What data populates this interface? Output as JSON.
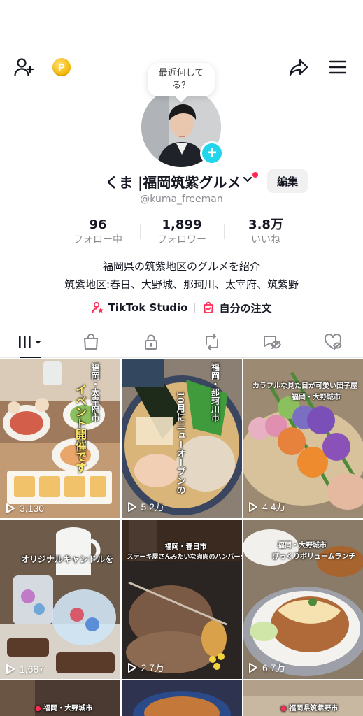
{
  "bubble": {
    "text": "最近何してる？"
  },
  "profile": {
    "display_name": "くま |福岡筑紫グルメ",
    "edit_label": "編集",
    "username": "@kuma_freeman"
  },
  "stats": [
    {
      "value": "96",
      "label": "フォロー中"
    },
    {
      "value": "1,899",
      "label": "フォロワー"
    },
    {
      "value": "3.8万",
      "label": "いいね"
    }
  ],
  "bio": {
    "line1": "福岡県の筑紫地区のグルメを紹介",
    "line2": "筑紫地区:春日、大野城、那珂川、太宰府、筑紫野"
  },
  "links": {
    "studio": "TikTok Studio",
    "orders": "自分の注文"
  },
  "videos": [
    {
      "views": "3,130",
      "overlay_vertical": "福岡・太宰府市",
      "overlay_caption": "イベント開催です"
    },
    {
      "views": "5.2万",
      "overlay_vertical": "福岡・那珂川市",
      "overlay_caption": "10月にニューオープンの"
    },
    {
      "views": "4.4万",
      "overlay_tag": "カラフルな見た目が可愛い団子屋",
      "overlay_location": "福岡・大野城市"
    },
    {
      "views": "1,687",
      "overlay_caption": "オリジナルキャンドルを"
    },
    {
      "views": "2.7万",
      "overlay_location": "福岡・春日市",
      "overlay_tag": "ステーキ屋さんみたいな肉肉のハンバーグ"
    },
    {
      "views": "6.7万",
      "overlay_location": "福岡・大野城市",
      "overlay_tag": "びっくりボリュームランチ"
    },
    {
      "overlay_location": "福岡・大野城市"
    },
    {},
    {
      "overlay_location": "福岡県筑紫野市"
    }
  ],
  "colors": {
    "accent_red": "#fe2c55",
    "accent_cyan": "#20d5ec",
    "coin_gold": "#f4b400",
    "text_primary": "#161823",
    "text_secondary": "#8a8b91"
  },
  "icons": {
    "top_left": [
      "add-friend-icon",
      "coin-icon"
    ],
    "top_right": [
      "share-icon",
      "menu-icon"
    ],
    "tabs": [
      "videos-grid-icon",
      "shop-bag-icon",
      "lock-icon",
      "repost-icon",
      "hidden-tag-icon",
      "liked-heart-icon"
    ]
  }
}
